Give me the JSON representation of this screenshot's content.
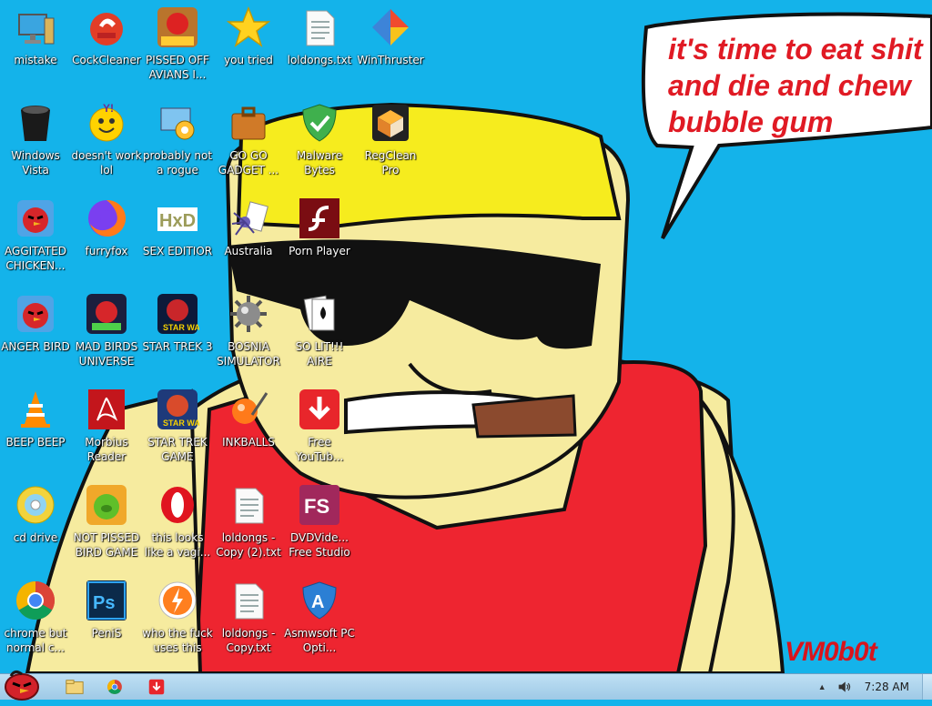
{
  "wallpaper": {
    "speech": [
      "it's time to eat shit",
      "and die and chew",
      "bubble gum"
    ],
    "signature": "VM0b0t"
  },
  "desktop": {
    "icons": [
      {
        "label": "mistake",
        "icon": "computer-icon"
      },
      {
        "label": "CockCleaner",
        "icon": "ccleaner-icon"
      },
      {
        "label": "PISSED OFF AVIANS I...",
        "icon": "angry-birds-seasons-icon"
      },
      {
        "label": "you tried",
        "icon": "star-icon"
      },
      {
        "label": "loldongs.txt",
        "icon": "text-file-icon"
      },
      {
        "label": "WinThruster",
        "icon": "winthruster-icon"
      },
      {
        "label": "Windows Vista",
        "icon": "trash-bin-icon"
      },
      {
        "label": "doesn't work lol",
        "icon": "yahoo-messenger-icon"
      },
      {
        "label": "probably not a rogue",
        "icon": "system-settings-icon"
      },
      {
        "label": "GO GO GADGET ...",
        "icon": "briefcase-icon"
      },
      {
        "label": "Malware Bytes",
        "icon": "shield-check-icon"
      },
      {
        "label": "RegClean Pro",
        "icon": "regclean-cube-icon"
      },
      {
        "label": "AGGITATED CHICKEN...",
        "icon": "angry-bird-red-icon"
      },
      {
        "label": "furryfox",
        "icon": "firefox-icon"
      },
      {
        "label": "SEX EDITIOR",
        "icon": "hxd-editor-icon"
      },
      {
        "label": "Australia",
        "icon": "spider-solitaire-icon"
      },
      {
        "label": "Porn Player",
        "icon": "flash-player-icon"
      },
      {
        "label": "ANGER BIRD",
        "icon": "angry-bird-red-icon"
      },
      {
        "label": "MAD BIRDS UNIVERSE",
        "icon": "angry-birds-space-icon"
      },
      {
        "label": "STAR TREK 3",
        "icon": "angry-birds-star-wars-icon"
      },
      {
        "label": "BOSNIA SIMULATOR",
        "icon": "minesweeper-mine-icon"
      },
      {
        "label": "SO LIT!!! AIRE",
        "icon": "solitaire-cards-icon"
      },
      {
        "label": "BEEP BEEP",
        "icon": "vlc-cone-icon"
      },
      {
        "label": "Morbius Reader",
        "icon": "adobe-reader-icon"
      },
      {
        "label": "STAR TREK GAME",
        "icon": "angry-birds-star-wars-2-icon"
      },
      {
        "label": "INKBALLS",
        "icon": "inkball-icon"
      },
      {
        "label": "Free YouTub...",
        "icon": "download-arrow-icon"
      },
      {
        "label": "cd drive",
        "icon": "cd-drive-icon"
      },
      {
        "label": "NOT PISSED BIRD GAME",
        "icon": "bad-piggies-icon"
      },
      {
        "label": "this looks like a vagi...",
        "icon": "opera-icon"
      },
      {
        "label": "loldongs - Copy (2).txt",
        "icon": "text-file-icon"
      },
      {
        "label": "DVDVide... Free Studio",
        "icon": "freestudio-icon"
      },
      {
        "label": "chrome but normal c...",
        "icon": "chrome-icon"
      },
      {
        "label": "PeniS",
        "icon": "photoshop-icon"
      },
      {
        "label": "who the fuck uses this",
        "icon": "avast-icon"
      },
      {
        "label": "loldongs - Copy.txt",
        "icon": "text-file-icon"
      },
      {
        "label": "Asmwsoft PC Opti...",
        "icon": "asmwsoft-icon"
      }
    ]
  },
  "taskbar": {
    "start": "start-orb-angry-bird-icon",
    "pinned": [
      "file-explorer-icon",
      "chrome-icon",
      "download-arrow-icon"
    ],
    "tray": {
      "show_hidden": "▲",
      "volume": "speaker-icon"
    },
    "clock": "7:28 AM"
  }
}
